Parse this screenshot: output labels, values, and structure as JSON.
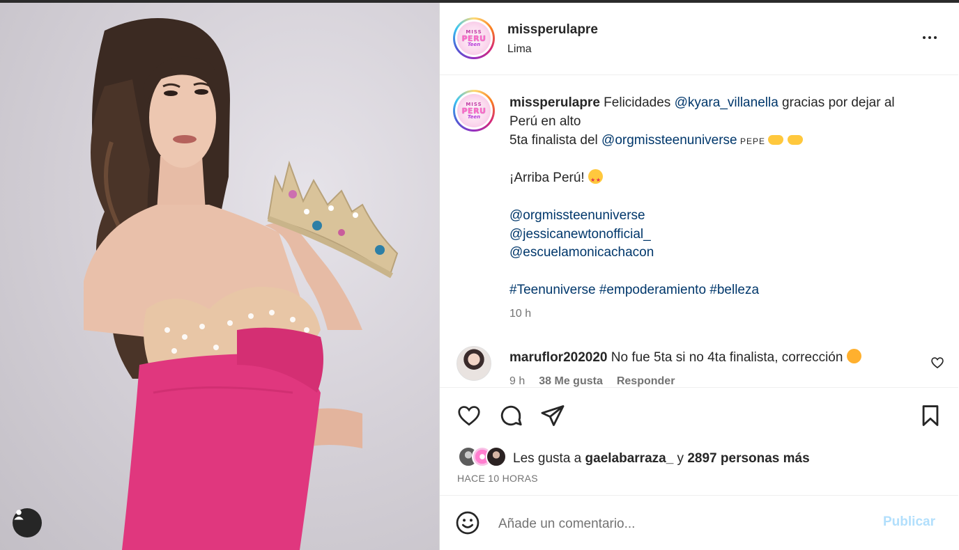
{
  "post": {
    "username": "missperulapre",
    "location": "Lima",
    "avatar_logo": {
      "line1": "MISS",
      "line2": "PERU",
      "line3": "Teen"
    }
  },
  "caption": {
    "username": "missperulapre",
    "line1_text": " Felicidades ",
    "line1_mention": "@kyara_villanella",
    "line1_rest": " gracias por dejar al",
    "line2": "Perú en alto",
    "line3_text": "5ta finalista del ",
    "line3_mention": "@orgmissteenuniverse",
    "line3_flag": " PEPE ",
    "line5": "¡Arriba Perú! ",
    "mention_1": "@orgmissteenuniverse",
    "mention_2": "@jessicanewtonofficial_",
    "mention_3": "@escuelamonicachacon",
    "hashtags": "#Teenuniverse #empoderamiento #belleza",
    "time": "10 h"
  },
  "comment": {
    "username": "maruflor202020",
    "text": " No fue 5ta si no 4ta finalista, corrección ",
    "time": "9 h",
    "likes": "38 Me gusta",
    "reply": "Responder"
  },
  "likes": {
    "prefix": "Les gusta a ",
    "user": "gaelabarraza_",
    "middle": " y ",
    "count": "2897 personas más"
  },
  "date": "HACE 10 HORAS",
  "compose": {
    "placeholder": "Añade un comentario...",
    "post_label": "Publicar"
  },
  "colors": {
    "mention": "#00376b",
    "secondary_text": "#737373",
    "post_button_disabled": "#b2dffc",
    "dress": "#e0377e"
  },
  "icons": [
    "profile-icon",
    "more-icon",
    "heart-icon",
    "comment-icon",
    "share-icon",
    "bookmark-icon",
    "emoji-icon"
  ]
}
